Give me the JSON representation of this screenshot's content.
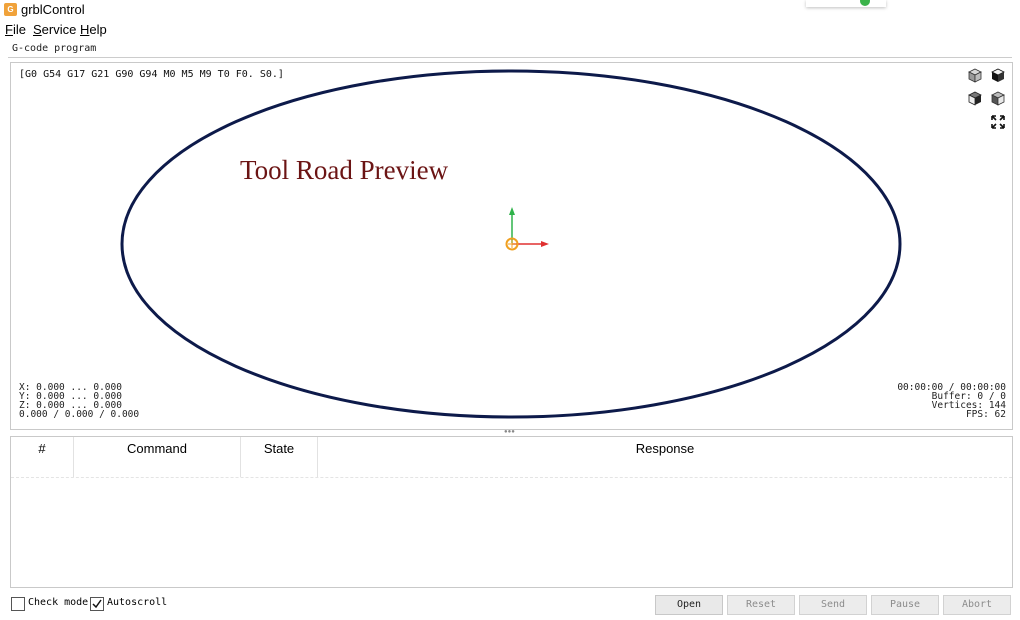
{
  "window": {
    "title": "grblControl",
    "app_icon": "grbl-app-icon"
  },
  "menu": {
    "file": "File",
    "service": "Service",
    "help": "Help"
  },
  "groupbox": {
    "title": "G-code program"
  },
  "viewer": {
    "modal_state": "[G0 G54 G17 G21 G90 G94 M0 M5 M9 T0 F0. S0.]",
    "preview_label": "Tool Road Preview",
    "view_buttons": [
      "isometric-view-icon",
      "top-view-icon",
      "front-view-icon",
      "left-view-icon",
      "fit-view-icon"
    ],
    "coords": {
      "x": "X: 0.000 ... 0.000",
      "y": "Y: 0.000 ... 0.000",
      "z": "Z: 0.000 ... 0.000",
      "xyz": "0.000 / 0.000 / 0.000"
    },
    "stats": {
      "time": "00:00:00 / 00:00:00",
      "buffer": "Buffer: 0 / 0",
      "vertices": "Vertices: 144",
      "fps": "FPS: 62"
    },
    "colors": {
      "toolpath": "#0d1a4a",
      "axis_x": "#e03030",
      "axis_y": "#2fb34a",
      "origin": "#f0a020",
      "label": "#6b1414"
    }
  },
  "console": {
    "columns": {
      "num": "#",
      "command": "Command",
      "state": "State",
      "response": "Response"
    }
  },
  "footer": {
    "check_mode": {
      "label": "Check mode",
      "checked": false
    },
    "autoscroll": {
      "label": "Autoscroll",
      "checked": true
    },
    "buttons": {
      "open": "Open",
      "reset": "Reset",
      "send": "Send",
      "pause": "Pause",
      "abort": "Abort"
    }
  }
}
